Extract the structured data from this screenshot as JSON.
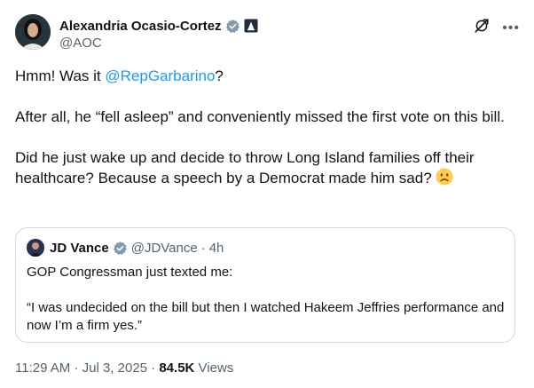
{
  "author": {
    "name": "Alexandria Ocasio-Cortez",
    "handle": "@AOC"
  },
  "tweet": {
    "line1_prefix": "Hmm! Was it ",
    "line1_mention": "@RepGarbarino",
    "line1_suffix": "?",
    "paragraph2": "After all, he “fell asleep” and conveniently missed the first vote on this bill.",
    "paragraph3": "Did he just wake up and decide to throw Long Island families off their healthcare? Because a speech by a Democrat made him sad?"
  },
  "quote": {
    "name": "JD Vance",
    "handle": "@JDVance",
    "separator": "·",
    "time": "4h",
    "line1": "GOP Congressman just texted me:",
    "line2": "“I was undecided on the bill but then I watched Hakeem Jeffries performance and now I’m a firm yes.”"
  },
  "meta": {
    "time": "11:29 AM",
    "dot1": "·",
    "date": "Jul 3, 2025",
    "dot2": "·",
    "views_count": "84.5K",
    "views_label": "Views"
  },
  "icons": {
    "verified": "verified-badge-icon",
    "affiliate": "government-affiliate-icon",
    "grok": "grok-icon",
    "more": "more-icon",
    "emoji": "frowning-face-emoji"
  },
  "colors": {
    "link": "#1d9bf0",
    "secondary_text": "#536471",
    "verified": "#829aab",
    "border": "#cfd9de"
  }
}
